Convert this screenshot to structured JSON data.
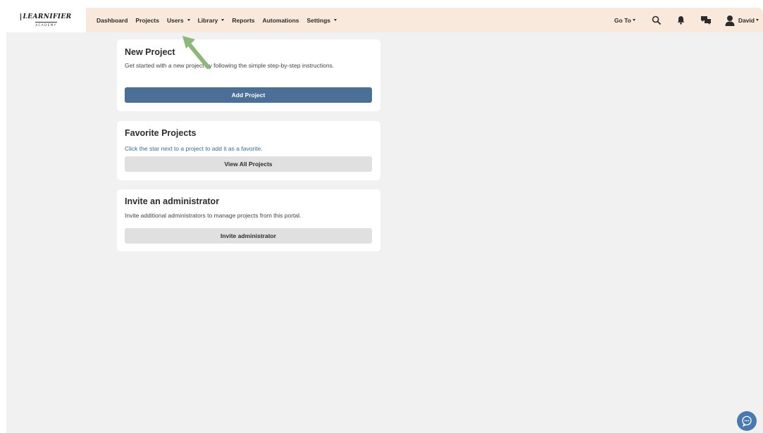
{
  "brand": {
    "logo_main": "LEARNIFIER",
    "logo_sub": "ACADEMY"
  },
  "nav": {
    "items": [
      {
        "label": "Dashboard",
        "has_caret": false
      },
      {
        "label": "Projects",
        "has_caret": false
      },
      {
        "label": "Users",
        "has_caret": true
      },
      {
        "label": "Library",
        "has_caret": true
      },
      {
        "label": "Reports",
        "has_caret": false
      },
      {
        "label": "Automations",
        "has_caret": false
      },
      {
        "label": "Settings",
        "has_caret": true
      }
    ],
    "goto_label": "Go To",
    "user_name": "David",
    "icons": [
      "search-icon",
      "bell-icon",
      "chat-bubbles-icon",
      "user-avatar-icon"
    ]
  },
  "cards": {
    "new_project": {
      "title": "New Project",
      "description": "Get started with a new project by following the simple step-by-step instructions.",
      "button": "Add Project"
    },
    "favorites": {
      "title": "Favorite Projects",
      "description": "Click the star next to a project to add it as a favorite.",
      "button": "View All Projects"
    },
    "invite": {
      "title": "Invite an administrator",
      "description": "Invite additional administrators to manage projects from this portal.",
      "button": "Invite administrator"
    }
  },
  "colors": {
    "topbar": "#f9e9dc",
    "primary_button": "#4b6f97",
    "secondary_button": "#e0e0e0",
    "link_text": "#3d6a92",
    "annotation_arrow": "#8db87c",
    "chat_button": "#4a79b0"
  }
}
